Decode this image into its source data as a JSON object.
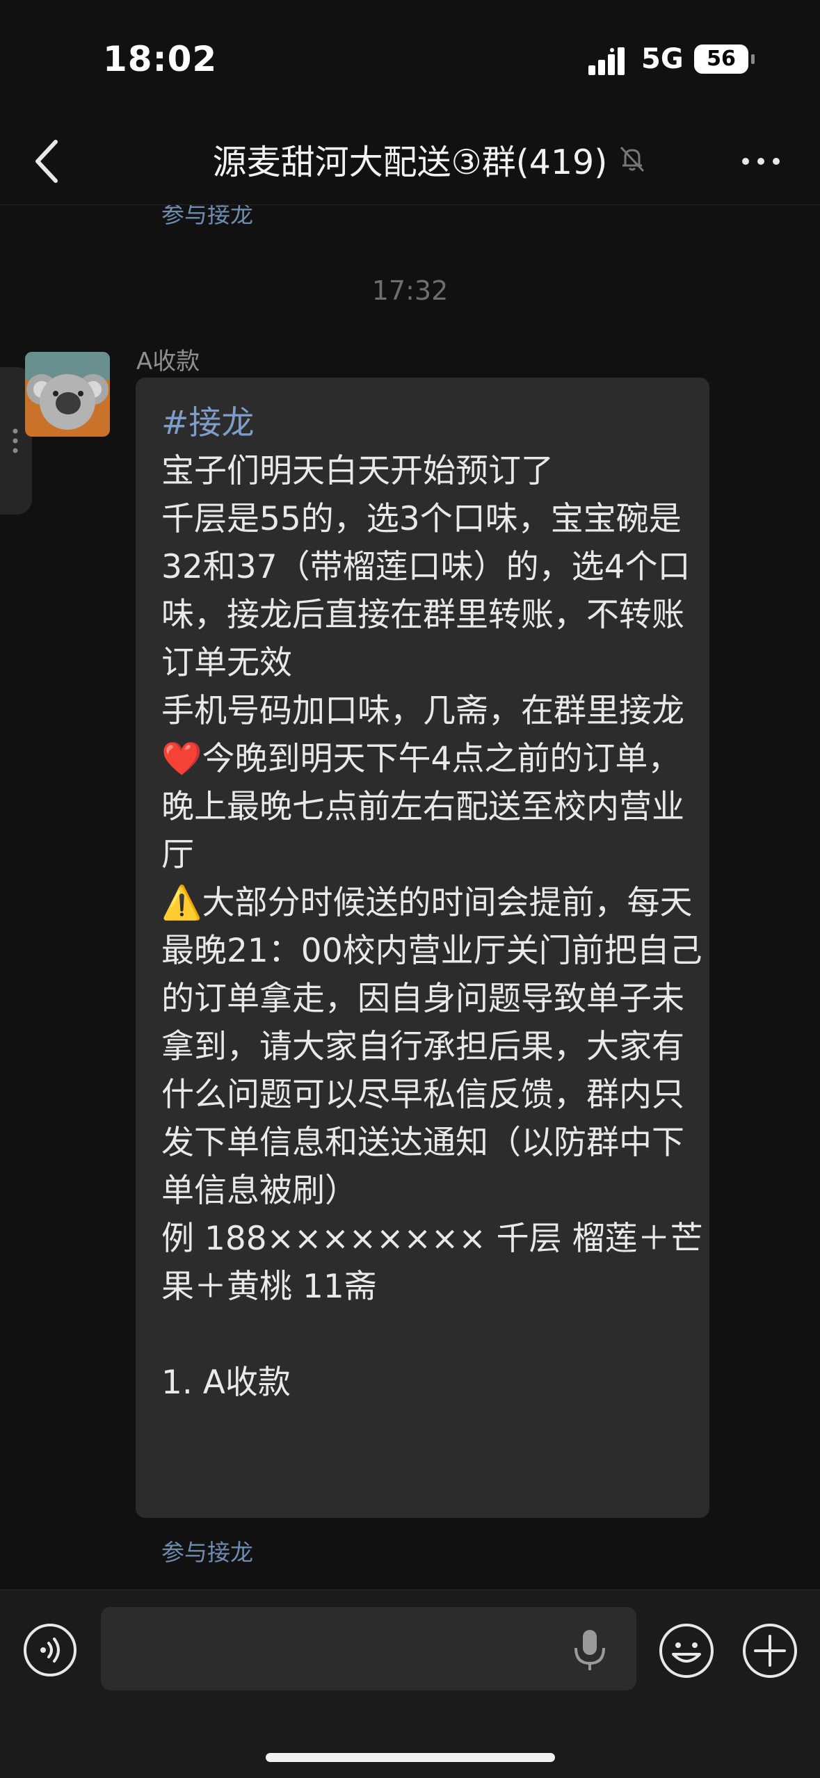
{
  "status_bar": {
    "time": "18:02",
    "network": "5G",
    "battery": "56"
  },
  "header": {
    "title": "源麦甜河大配送③群(419)"
  },
  "messages": {
    "join_link_previous": "参与接龙",
    "timestamp": "17:32",
    "sender_name": "A收款",
    "hashtag": "#接龙",
    "body": "宝子们明天白天开始预订了\n千层是55的，选3个口味，宝宝碗是32和37（带榴莲口味）的，选4个口味，接龙后直接在群里转账，不转账订单无效\n手机号码加口味，几斋，在群里接龙\n❤️今晚到明天下午4点之前的订单，晚上最晚七点前左右配送至校内营业厅\n⚠️大部分时候送的时间会提前，每天最晚21：00校内营业厅关门前把自己的订单拿走，因自身问题导致单子未拿到，请大家自行承担后果，大家有什么问题可以尽早私信反馈，群内只发下单信息和送达通知（以防群中下单信息被刷）\n例 188×××××××× 千层 榴莲＋芒果＋黄桃 11斋\n\n1. A收款",
    "join_link": "参与接龙"
  },
  "icons": {
    "back": "chevron-left-icon",
    "mute": "bell-off-icon",
    "more": "more-dots-icon",
    "voice": "voice-input-icon",
    "mic": "microphone-icon",
    "emoji": "emoji-icon",
    "plus": "plus-icon",
    "avatar": "koala-avatar"
  },
  "colors": {
    "background": "#111111",
    "bubble": "#2c2c2c",
    "link": "#6f8bb0",
    "hashtag": "#7f9dc9"
  }
}
